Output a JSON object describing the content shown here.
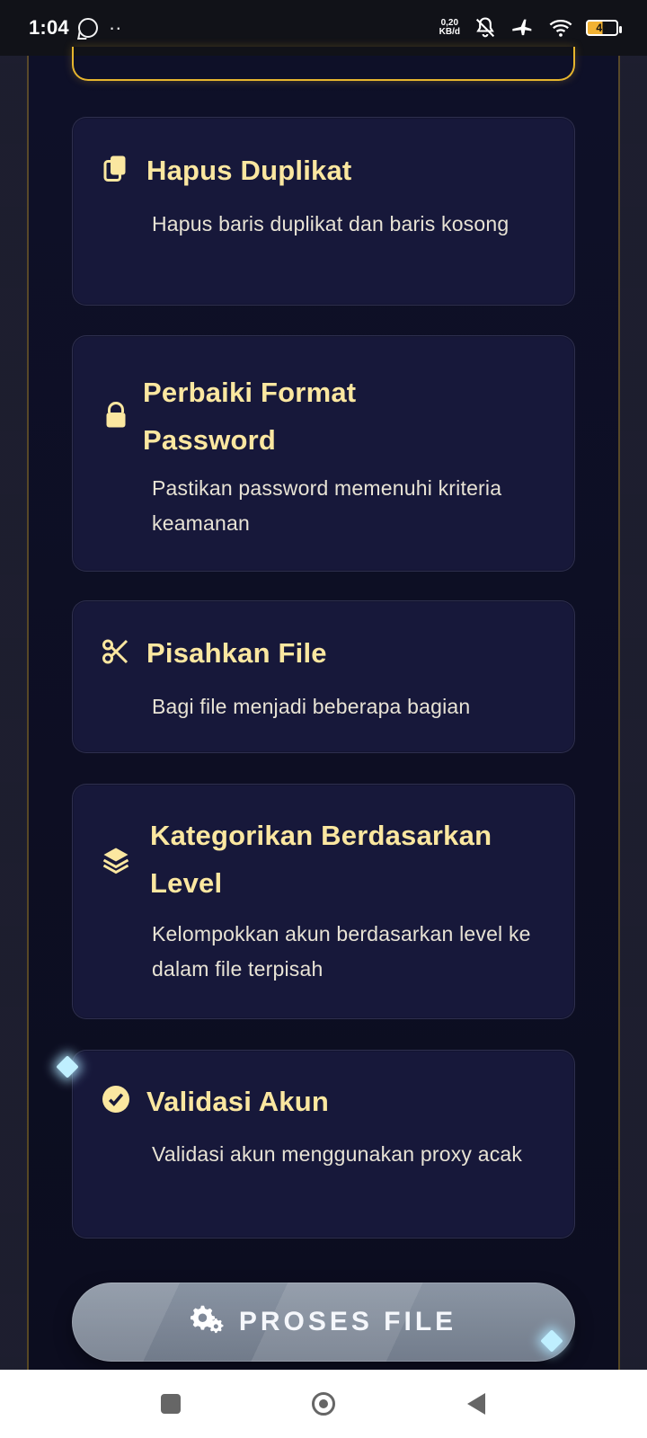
{
  "status_bar": {
    "time": "1:04",
    "dots": "··",
    "net_speed_value": "0,20",
    "net_speed_unit": "KB/d",
    "battery_level": "49"
  },
  "cards": [
    {
      "icon": "copy-icon",
      "title": "Hapus Duplikat",
      "description": "Hapus baris duplikat dan baris kosong"
    },
    {
      "icon": "lock-icon",
      "title": "Perbaiki Format Password",
      "description": "Pastikan password memenuhi kriteria keamanan"
    },
    {
      "icon": "scissors-icon",
      "title": "Pisahkan File",
      "description": "Bagi file menjadi beberapa bagian"
    },
    {
      "icon": "layers-icon",
      "title": "Kategorikan Berdasarkan Level",
      "description": "Kelompokkan akun berdasarkan level ke dalam file terpisah"
    },
    {
      "icon": "check-circle-icon",
      "title": "Validasi Akun",
      "description": "Validasi akun menggunakan proxy acak"
    }
  ],
  "action": {
    "label": "PROSES FILE",
    "icon": "gears-icon"
  },
  "navigation": {
    "recents_icon": "square-icon",
    "home_icon": "home-circle-icon",
    "back_icon": "back-triangle-icon"
  },
  "colors": {
    "accent_gold": "#e6b52e",
    "card_title": "#fbe7a0",
    "button_gray": "#7f8999"
  }
}
